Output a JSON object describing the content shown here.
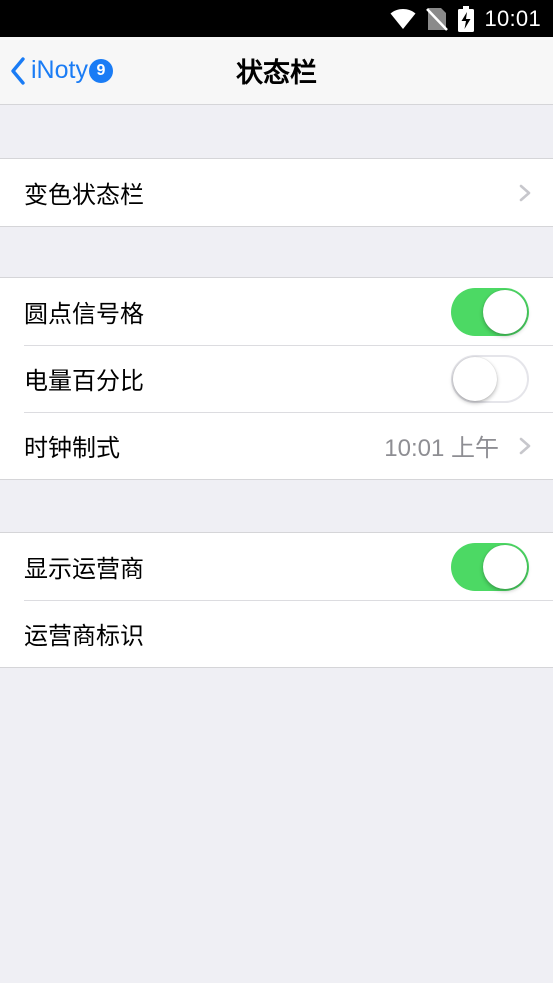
{
  "status_bar": {
    "time": "10:01",
    "icons": [
      "wifi-icon",
      "no-sim-icon",
      "battery-charging-icon"
    ],
    "background": "#000000"
  },
  "nav": {
    "back_label": "iNoty",
    "back_badge": "9",
    "title": "状态栏",
    "accent": "#1a7cf5"
  },
  "groups": [
    {
      "rows": [
        {
          "label": "变色状态栏",
          "control": "chevron"
        }
      ]
    },
    {
      "rows": [
        {
          "label": "圆点信号格",
          "control": "toggle",
          "on": true
        },
        {
          "label": "电量百分比",
          "control": "toggle",
          "on": false
        },
        {
          "label": "时钟制式",
          "control": "value-chevron",
          "value": "10:01 上午"
        }
      ]
    },
    {
      "rows": [
        {
          "label": "显示运营商",
          "control": "toggle",
          "on": true
        },
        {
          "label": "运营商标识",
          "control": "none"
        }
      ]
    }
  ],
  "colors": {
    "toggle_on": "#4cd964",
    "background": "#efeff4",
    "secondary_text": "#8e8e93"
  }
}
